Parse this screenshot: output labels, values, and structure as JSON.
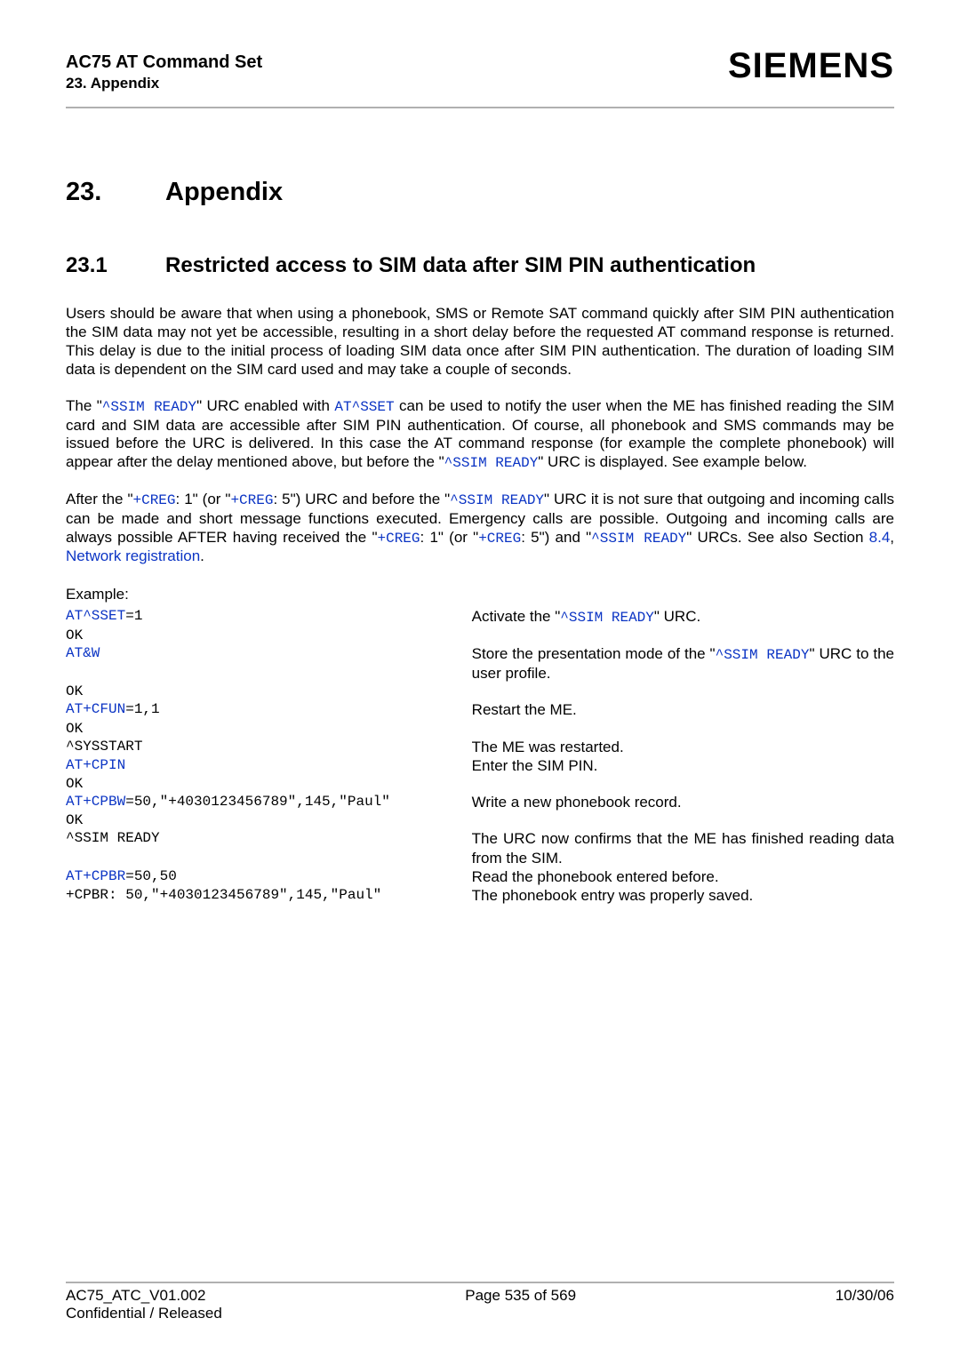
{
  "header": {
    "doc_title": "AC75 AT Command Set",
    "doc_sub": "23. Appendix",
    "logo": "SIEMENS"
  },
  "chapter": {
    "num": "23.",
    "title": "Appendix"
  },
  "section": {
    "num": "23.1",
    "title": "Restricted access to SIM data after SIM PIN authentication"
  },
  "para1": "Users should be aware that when using a phonebook, SMS or Remote SAT command quickly after SIM PIN authentication the SIM data may not yet be accessible, resulting in a short delay before the requested AT command response is returned. This delay is due to the initial process of loading SIM data once after SIM PIN authentication. The duration of loading SIM data is dependent on the SIM card used and may take a couple of seconds.",
  "p2": {
    "t1": "The \"",
    "c1": "^SSIM READY",
    "t2": "\" URC enabled with ",
    "c2": "AT^SSET",
    "t3": " can be used to notify the user when the ME has finished reading the SIM card and SIM data are accessible after SIM PIN authentication. Of course, all phonebook and SMS commands may be issued before the URC is delivered. In this case the AT command response (for example the complete phonebook) will appear after the delay mentioned above, but before the \"",
    "c3": "^SSIM READY",
    "t4": "\" URC is displayed. See example below."
  },
  "p3": {
    "t1": "After the \"",
    "c1": "+CREG",
    "t2": ": 1\" (or \"",
    "c2": "+CREG",
    "t3": ": 5\") URC and before the \"",
    "c3": "^SSIM READY",
    "t4": "\" URC it is not sure that outgoing and incoming calls can be made and short message functions executed. Emergency calls are possible. Outgoing and incoming calls are always possible AFTER having received the \"",
    "c4": "+CREG",
    "t5": ": 1\" (or \"",
    "c5": "+CREG",
    "t6": ": 5\") and \"",
    "c6": "^SSIM READY",
    "t7": "\" URCs. See also Section ",
    "l1": "8.4",
    "t8": ", ",
    "l2": "Network registration",
    "t9": "."
  },
  "example_label": "Example:",
  "rows": [
    {
      "l": {
        "link": "AT^SSET",
        "plain": "=1"
      },
      "r": {
        "t1": "Activate the \"",
        "c": "^SSIM READY",
        "t2": "\" URC."
      }
    },
    {
      "l": {
        "plain": "OK"
      },
      "r": {}
    },
    {
      "l": {
        "link": "AT&W"
      },
      "r": {
        "t1": "Store the presentation mode of the \"",
        "c": "^SSIM READY",
        "t2": "\" URC to the user profile."
      }
    },
    {
      "l": {
        "plain": "OK"
      },
      "r": {}
    },
    {
      "l": {
        "link": "AT+CFUN",
        "plain": "=1,1"
      },
      "r": {
        "t1": "Restart the ME."
      }
    },
    {
      "l": {
        "plain": "OK"
      },
      "r": {}
    },
    {
      "l": {
        "plain": "^SYSSTART"
      },
      "r": {
        "t1": "The ME was restarted."
      }
    },
    {
      "l": {
        "link": "AT+CPIN"
      },
      "r": {
        "t1": "Enter the SIM PIN."
      }
    },
    {
      "l": {
        "plain": "OK"
      },
      "r": {}
    },
    {
      "l": {
        "link": "AT+CPBW",
        "plain": "=50,\"+4030123456789\",145,\"Paul\""
      },
      "r": {
        "t1": "Write a new phonebook record."
      }
    },
    {
      "l": {
        "plain": "OK"
      },
      "r": {}
    },
    {
      "l": {
        "plain": "^SSIM READY"
      },
      "r": {
        "t1": "The URC now confirms that the ME has finished reading data from the SIM."
      }
    },
    {
      "l": {
        "link": "AT+CPBR",
        "plain": "=50,50"
      },
      "r": {
        "t1": "Read the phonebook entered before."
      }
    },
    {
      "l": {
        "plain": "+CPBR: 50,\"+4030123456789\",145,\"Paul\""
      },
      "r": {
        "t1": "The phonebook entry was properly saved."
      }
    }
  ],
  "footer": {
    "left": "AC75_ATC_V01.002",
    "center": "Page 535 of 569",
    "right": "10/30/06",
    "sub": "Confidential / Released"
  }
}
